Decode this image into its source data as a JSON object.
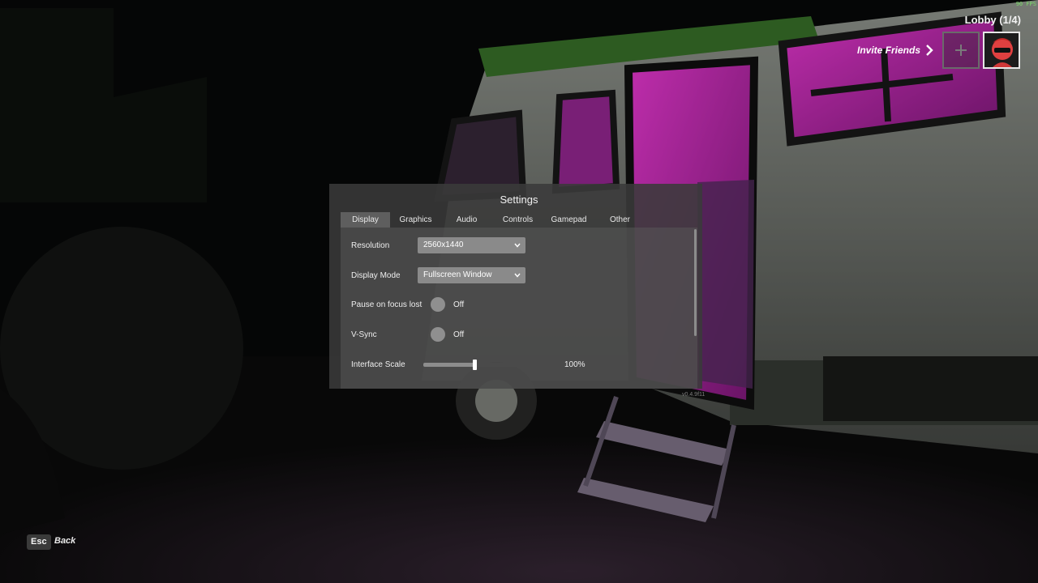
{
  "hud": {
    "fps": "90 FPS",
    "lobby_label": "Lobby (1/4)",
    "invite_label": "Invite Friends"
  },
  "settings": {
    "title": "Settings",
    "tabs": [
      "Display",
      "Graphics",
      "Audio",
      "Controls",
      "Gamepad",
      "Other"
    ],
    "active_tab": "Display",
    "rows": {
      "resolution": {
        "label": "Resolution",
        "value": "2560x1440"
      },
      "display_mode": {
        "label": "Display Mode",
        "value": "Fullscreen Window"
      },
      "pause_focus": {
        "label": "Pause on focus lost",
        "state": "Off"
      },
      "vsync": {
        "label": "V-Sync",
        "state": "Off"
      },
      "interface_scale": {
        "label": "Interface Scale",
        "value_text": "100%",
        "level": 0.38
      }
    },
    "version": "v0.4.9f11"
  },
  "footer": {
    "key": "Esc",
    "action": "Back"
  },
  "icons": {
    "invite": "chevron-right-icon",
    "add_slot": "plus-icon",
    "dropdown": "chevron-down-icon"
  },
  "colors": {
    "accent_pink": "#d21fbf",
    "fps_green": "#7bdc6a",
    "panel_bg": "#3a3a3a"
  }
}
